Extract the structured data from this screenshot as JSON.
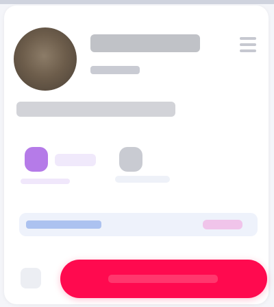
{
  "profile": {
    "username": "",
    "handle": "",
    "bio": ""
  },
  "stats": [
    {
      "label": "",
      "icon": "purple-badge-icon",
      "color": "#b57be8"
    },
    {
      "label": "",
      "icon": "grey-badge-icon",
      "color": "#c9cbd2"
    }
  ],
  "link": {
    "text": "",
    "action": ""
  },
  "cta": {
    "label": "",
    "color": "#ff0a4f"
  },
  "colors": {
    "accent": "#ff0a4f",
    "card": "#ffffff",
    "background": "#f4f5f9"
  }
}
